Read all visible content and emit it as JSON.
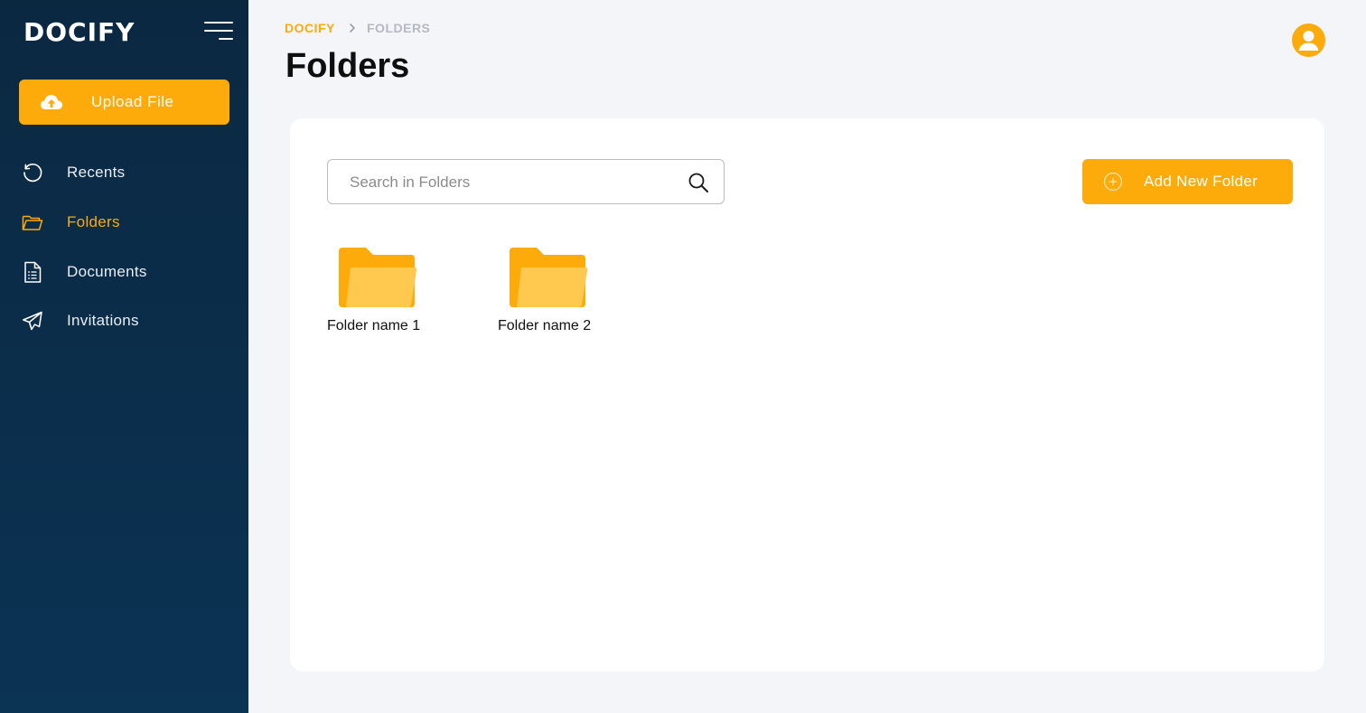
{
  "app": {
    "name": "DOCIFY"
  },
  "colors": {
    "accent": "#fdab0a",
    "sidebar_bg": "#0b2841",
    "page_bg": "#f3f5f9",
    "card_bg": "#ffffff"
  },
  "sidebar": {
    "upload_label": "Upload File",
    "upload_icon": "cloud-upload-icon",
    "items": [
      {
        "label": "Recents",
        "icon": "history-icon",
        "active": false
      },
      {
        "label": "Folders",
        "icon": "folder-icon",
        "active": true
      },
      {
        "label": "Documents",
        "icon": "document-icon",
        "active": false
      },
      {
        "label": "Invitations",
        "icon": "paper-plane-icon",
        "active": false
      }
    ]
  },
  "breadcrumb": {
    "root": "DOCIFY",
    "current": "FOLDERS"
  },
  "page": {
    "title": "Folders"
  },
  "search": {
    "placeholder": "Search in Folders",
    "value": ""
  },
  "actions": {
    "add_folder_label": "Add New Folder"
  },
  "folders": [
    {
      "name": "Folder name 1"
    },
    {
      "name": "Folder name 2"
    }
  ]
}
